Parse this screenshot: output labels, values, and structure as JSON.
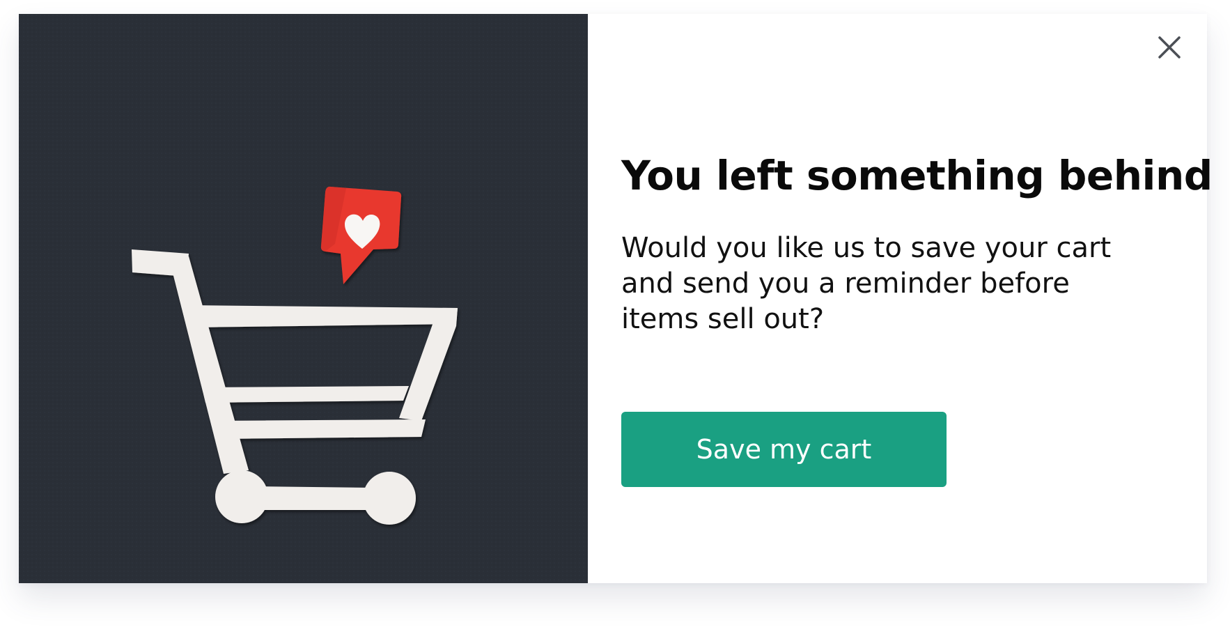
{
  "popup": {
    "title": "You left something behind",
    "message": "Would you like us to save your cart and send you a reminder before items sell out?",
    "cta_label": "Save my cart",
    "close_icon": "close-icon",
    "image": {
      "subject": "paper-cut shopping cart with heart notification",
      "icons": [
        "shopping-cart-icon",
        "heart-notification-icon"
      ]
    },
    "colors": {
      "accent": "#1aa082",
      "image_background": "#2a2f37",
      "notification_red": "#e8392f",
      "title": "#0a0a0a"
    }
  }
}
